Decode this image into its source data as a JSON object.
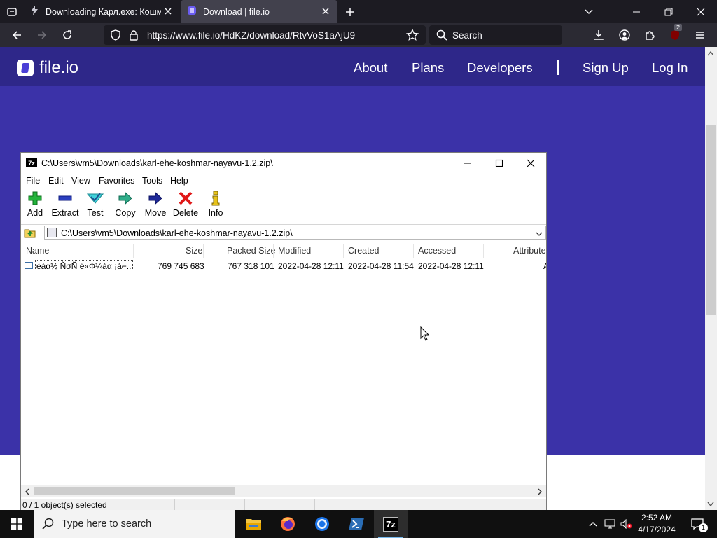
{
  "browser": {
    "tabs": [
      {
        "title": "Downloading Карл.exe: Кошмар",
        "active": false
      },
      {
        "title": "Download | file.io",
        "active": true
      }
    ],
    "url": "https://www.file.io/HdKZ/download/RtvVoS1aAjU9",
    "search_placeholder": "Search",
    "extension_badge": "2"
  },
  "site": {
    "logo": "file.io",
    "nav": [
      "About",
      "Plans",
      "Developers",
      "Sign Up",
      "Log In"
    ]
  },
  "sevenzip": {
    "title": "C:\\Users\\vm5\\Downloads\\karl-ehe-koshmar-nayavu-1.2.zip\\",
    "app_icon": "7z",
    "menu": [
      "File",
      "Edit",
      "View",
      "Favorites",
      "Tools",
      "Help"
    ],
    "tools": [
      "Add",
      "Extract",
      "Test",
      "Copy",
      "Move",
      "Delete",
      "Info"
    ],
    "address": "C:\\Users\\vm5\\Downloads\\karl-ehe-koshmar-nayavu-1.2.zip\\",
    "columns": [
      "Name",
      "Size",
      "Packed Size",
      "Modified",
      "Created",
      "Accessed",
      "Attributes"
    ],
    "files": [
      {
        "name": "ѐáα½ ÑσÑ ё«Ф¼áα ¡á⌐...",
        "size": "769 745 683",
        "packed": "767 318 101",
        "modified": "2022-04-28 12:11",
        "created": "2022-04-28 11:54",
        "accessed": "2022-04-28 12:11",
        "attributes": "A"
      }
    ],
    "status": "0 / 1 object(s) selected"
  },
  "taskbar": {
    "search_placeholder": "Type here to search",
    "time": "2:52 AM",
    "date": "4/17/2024",
    "notification_count": "1",
    "active_app_label": "7z"
  }
}
